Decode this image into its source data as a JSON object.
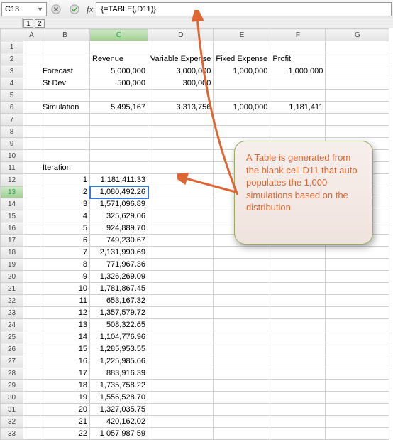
{
  "toolbar": {
    "namebox": "C13",
    "formula": "{=TABLE(,D11)}"
  },
  "outline": {
    "levels": [
      "1",
      "2"
    ]
  },
  "columns": [
    "A",
    "B",
    "C",
    "D",
    "E",
    "F",
    "G"
  ],
  "selected": {
    "col": "C",
    "row": "13"
  },
  "headers": {
    "c2": "Revenue",
    "d2": "Variable Expense",
    "e2": "Fixed Expense",
    "f2": "Profit",
    "b3": "Forecast",
    "b4": "St Dev",
    "b6": "Simulation",
    "b11": "Iteration"
  },
  "vals": {
    "c3": "5,000,000",
    "d3": "3,000,000",
    "e3": "1,000,000",
    "f3": "1,000,000",
    "c4": "500,000",
    "d4": "300,000",
    "c6": "5,495,167",
    "d6": "3,313,756",
    "e6": "1,000,000",
    "f6": "1,181,411"
  },
  "iter_labels": [
    "1",
    "2",
    "3",
    "4",
    "5",
    "6",
    "7",
    "8",
    "9",
    "10",
    "11",
    "12",
    "13",
    "14",
    "15",
    "16",
    "17",
    "18",
    "19",
    "20",
    "21",
    "22"
  ],
  "iter_values": [
    "1,181,411.33",
    "1,080,492.26",
    "1,571,096.89",
    "325,629.06",
    "924,889.70",
    "749,230.67",
    "2,131,990.69",
    "771,967.36",
    "1,326,269.09",
    "1,781,867.45",
    "653,167.32",
    "1,357,579.72",
    "508,322.65",
    "1,104,776.96",
    "1,285,953.55",
    "1,225,985.66",
    "883,916.39",
    "1,735,758.22",
    "1,556,528.70",
    "1,327,035.75",
    "420,162.02",
    "1 057 987 59"
  ],
  "callout": "A Table is generated from the blank cell D11 that auto populates the 1,000 simulations based on the distribution"
}
